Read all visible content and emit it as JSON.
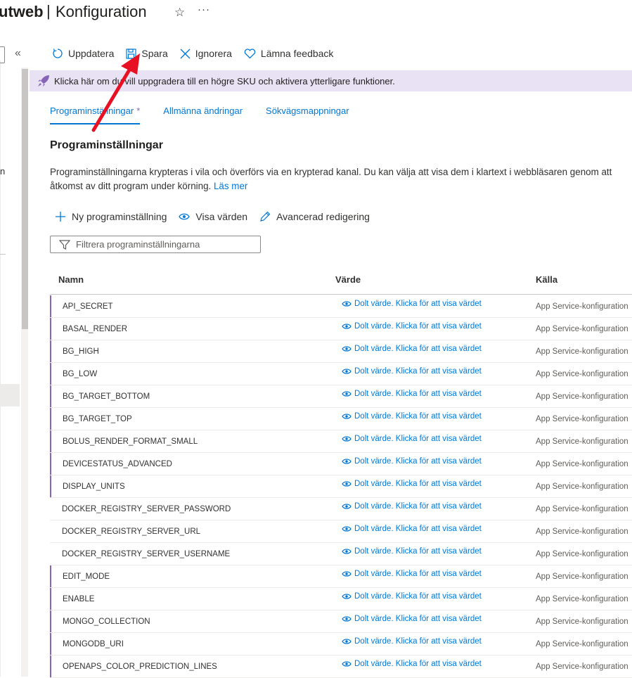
{
  "header": {
    "app_name_fragment": "utweb",
    "separator": "|",
    "page_title": "Konfiguration",
    "favorite_icon": "star-icon",
    "more_icon": "ellipsis-icon"
  },
  "left_panel": {
    "collapse_glyph": "«",
    "text_fragment": "n"
  },
  "toolbar": {
    "refresh_label": "Uppdatera",
    "save_label": "Spara",
    "discard_label": "Ignorera",
    "feedback_label": "Lämna feedback"
  },
  "banner": {
    "text": "Klicka här om du vill uppgradera till en högre SKU och aktivera ytterligare funktioner.",
    "color": "#e9e2f4"
  },
  "tabs": [
    {
      "label": "Programinställningar",
      "active": true,
      "modified_marker": "*"
    },
    {
      "label": "Allmänna ändringar",
      "active": false
    },
    {
      "label": "Sökvägsmappningar",
      "active": false
    }
  ],
  "section": {
    "title": "Programinställningar",
    "description_line1": "Programinställningarna krypteras i vila och överförs via en krypterad kanal. Du kan välja att visa dem i klartext i webbläsaren genom att",
    "description_line2": "åtkomst av ditt program under körning.",
    "learn_more": "Läs mer"
  },
  "actions": {
    "new_label": "Ny programinställning",
    "show_values_label": "Visa värden",
    "advanced_edit_label": "Avancerad redigering"
  },
  "filter": {
    "placeholder": "Filtrera programinställningarna"
  },
  "table": {
    "columns": [
      "Namn",
      "Värde",
      "Källa"
    ],
    "rows": [
      {
        "name": "API_SECRET",
        "value": "Dolt värde. Klicka för att visa värdet",
        "source": "App Service-konfiguration",
        "modified": true
      },
      {
        "name": "BASAL_RENDER",
        "value": "Dolt värde. Klicka för att visa värdet",
        "source": "App Service-konfiguration",
        "modified": true
      },
      {
        "name": "BG_HIGH",
        "value": "Dolt värde. Klicka för att visa värdet",
        "source": "App Service-konfiguration",
        "modified": true
      },
      {
        "name": "BG_LOW",
        "value": "Dolt värde. Klicka för att visa värdet",
        "source": "App Service-konfiguration",
        "modified": true
      },
      {
        "name": "BG_TARGET_BOTTOM",
        "value": "Dolt värde. Klicka för att visa värdet",
        "source": "App Service-konfiguration",
        "modified": true
      },
      {
        "name": "BG_TARGET_TOP",
        "value": "Dolt värde. Klicka för att visa värdet",
        "source": "App Service-konfiguration",
        "modified": true
      },
      {
        "name": "BOLUS_RENDER_FORMAT_SMALL",
        "value": "Dolt värde. Klicka för att visa värdet",
        "source": "App Service-konfiguration",
        "modified": true
      },
      {
        "name": "DEVICESTATUS_ADVANCED",
        "value": "Dolt värde. Klicka för att visa värdet",
        "source": "App Service-konfiguration",
        "modified": true
      },
      {
        "name": "DISPLAY_UNITS",
        "value": "Dolt värde. Klicka för att visa värdet",
        "source": "App Service-konfiguration",
        "modified": true
      },
      {
        "name": "DOCKER_REGISTRY_SERVER_PASSWORD",
        "value": "Dolt värde. Klicka för att visa värdet",
        "source": "App Service-konfiguration",
        "modified": false
      },
      {
        "name": "DOCKER_REGISTRY_SERVER_URL",
        "value": "Dolt värde. Klicka för att visa värdet",
        "source": "App Service-konfiguration",
        "modified": false
      },
      {
        "name": "DOCKER_REGISTRY_SERVER_USERNAME",
        "value": "Dolt värde. Klicka för att visa värdet",
        "source": "App Service-konfiguration",
        "modified": false
      },
      {
        "name": "EDIT_MODE",
        "value": "Dolt värde. Klicka för att visa värdet",
        "source": "App Service-konfiguration",
        "modified": true
      },
      {
        "name": "ENABLE",
        "value": "Dolt värde. Klicka för att visa värdet",
        "source": "App Service-konfiguration",
        "modified": true
      },
      {
        "name": "MONGO_COLLECTION",
        "value": "Dolt värde. Klicka för att visa värdet",
        "source": "App Service-konfiguration",
        "modified": true
      },
      {
        "name": "MONGODB_URI",
        "value": "Dolt värde. Klicka för att visa värdet",
        "source": "App Service-konfiguration",
        "modified": true
      },
      {
        "name": "OPENAPS_COLOR_PREDICTION_LINES",
        "value": "Dolt värde. Klicka för att visa värdet",
        "source": "App Service-konfiguration",
        "modified": true
      }
    ]
  },
  "colors": {
    "accent": "#0078d4",
    "modified_marker": "#8764b8",
    "annotation_arrow": "#e81123"
  }
}
